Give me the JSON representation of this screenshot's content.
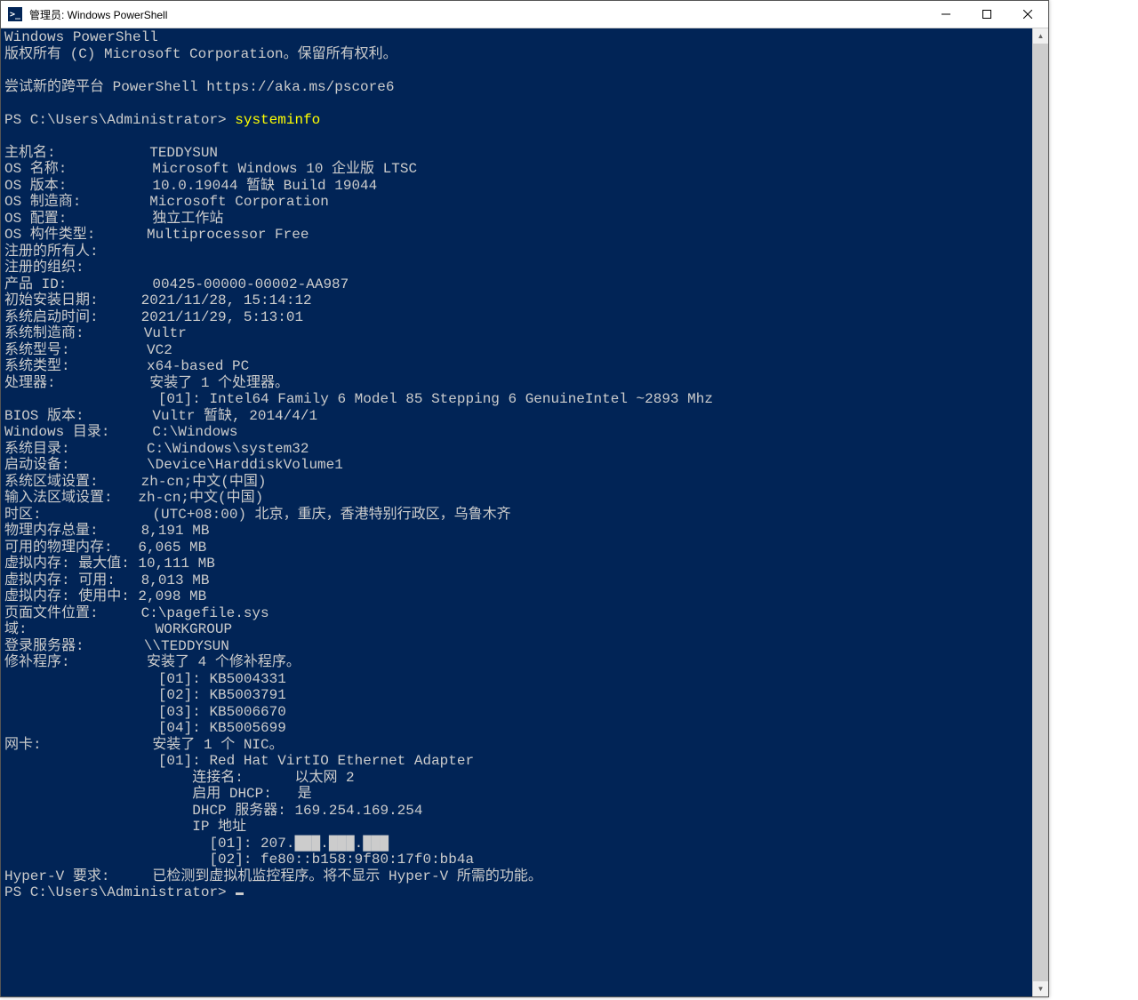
{
  "window": {
    "title": "管理员: Windows PowerShell",
    "icon_glyph": ">_"
  },
  "header": {
    "banner1": "Windows PowerShell",
    "banner2": "版权所有 (C) Microsoft Corporation。保留所有权利。",
    "banner3": "尝试新的跨平台 PowerShell https://aka.ms/pscore6"
  },
  "prompt": {
    "ps1": "PS C:\\Users\\Administrator>",
    "command": "systeminfo"
  },
  "info": [
    {
      "label": "主机名:",
      "value": "TEDDYSUN"
    },
    {
      "label": "OS 名称:",
      "value": "Microsoft Windows 10 企业版 LTSC"
    },
    {
      "label": "OS 版本:",
      "value": "10.0.19044 暂缺 Build 19044"
    },
    {
      "label": "OS 制造商:",
      "value": "Microsoft Corporation"
    },
    {
      "label": "OS 配置:",
      "value": "独立工作站"
    },
    {
      "label": "OS 构件类型:",
      "value": "Multiprocessor Free"
    },
    {
      "label": "注册的所有人:",
      "value": ""
    },
    {
      "label": "注册的组织:",
      "value": ""
    },
    {
      "label": "产品 ID:",
      "value": "00425-00000-00002-AA987"
    },
    {
      "label": "初始安装日期:",
      "value": "2021/11/28, 15:14:12"
    },
    {
      "label": "系统启动时间:",
      "value": "2021/11/29, 5:13:01"
    },
    {
      "label": "系统制造商:",
      "value": "Vultr"
    },
    {
      "label": "系统型号:",
      "value": "VC2"
    },
    {
      "label": "系统类型:",
      "value": "x64-based PC"
    },
    {
      "label": "处理器:",
      "value": "安装了 1 个处理器。"
    },
    {
      "label": "",
      "value": "[01]: Intel64 Family 6 Model 85 Stepping 6 GenuineIntel ~2893 Mhz"
    },
    {
      "label": "BIOS 版本:",
      "value": "Vultr 暂缺, 2014/4/1"
    },
    {
      "label": "Windows 目录:",
      "value": "C:\\Windows"
    },
    {
      "label": "系统目录:",
      "value": "C:\\Windows\\system32"
    },
    {
      "label": "启动设备:",
      "value": "\\Device\\HarddiskVolume1"
    },
    {
      "label": "系统区域设置:",
      "value": "zh-cn;中文(中国)"
    },
    {
      "label": "输入法区域设置:",
      "value": "zh-cn;中文(中国)"
    },
    {
      "label": "时区:",
      "value": "(UTC+08:00) 北京，重庆，香港特别行政区，乌鲁木齐"
    },
    {
      "label": "物理内存总量:",
      "value": "8,191 MB"
    },
    {
      "label": "可用的物理内存:",
      "value": "6,065 MB"
    },
    {
      "label": "虚拟内存: 最大值:",
      "value": "10,111 MB"
    },
    {
      "label": "虚拟内存: 可用:",
      "value": "8,013 MB"
    },
    {
      "label": "虚拟内存: 使用中:",
      "value": "2,098 MB"
    },
    {
      "label": "页面文件位置:",
      "value": "C:\\pagefile.sys"
    },
    {
      "label": "域:",
      "value": "WORKGROUP"
    },
    {
      "label": "登录服务器:",
      "value": "\\\\TEDDYSUN"
    },
    {
      "label": "修补程序:",
      "value": "安装了 4 个修补程序。"
    },
    {
      "label": "",
      "value": "[01]: KB5004331"
    },
    {
      "label": "",
      "value": "[02]: KB5003791"
    },
    {
      "label": "",
      "value": "[03]: KB5006670"
    },
    {
      "label": "",
      "value": "[04]: KB5005699"
    },
    {
      "label": "网卡:",
      "value": "安装了 1 个 NIC。"
    },
    {
      "label": "",
      "value": "[01]: Red Hat VirtIO Ethernet Adapter"
    },
    {
      "label": "",
      "value": "    连接名:      以太网 2"
    },
    {
      "label": "",
      "value": "    启用 DHCP:   是"
    },
    {
      "label": "",
      "value": "    DHCP 服务器: 169.254.169.254"
    },
    {
      "label": "",
      "value": "    IP 地址"
    },
    {
      "label": "",
      "value": "      [01]: 207.███.███.███"
    },
    {
      "label": "",
      "value": "      [02]: fe80::b158:9f80:17f0:bb4a"
    },
    {
      "label": "Hyper-V 要求:",
      "value": "已检测到虚拟机监控程序。将不显示 Hyper-V 所需的功能。"
    }
  ],
  "final_prompt": "PS C:\\Users\\Administrator>"
}
